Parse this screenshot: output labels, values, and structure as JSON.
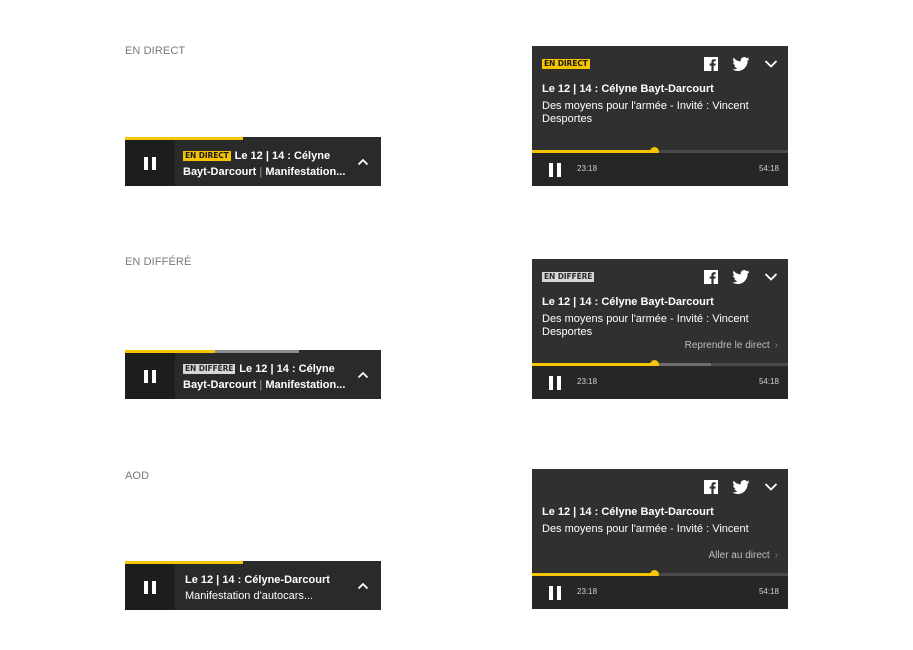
{
  "sections": [
    {
      "label": "EN DIRECT",
      "mini": {
        "badge": "EN DIRECT",
        "line1": "Le 12 | 14 : Célyne",
        "line2_bold": "Bayt-Darcourt",
        "line2_sep": " | ",
        "line2_rest": "Manifestation...",
        "progress_percent": 46,
        "buffer_percent": 46
      },
      "full": {
        "badge": "EN DIRECT",
        "title": "Le 12 | 14 : Célyne Bayt-Darcourt",
        "description": "Des moyens pour l'armée - Invité : Vincent Desportes",
        "link": "",
        "progress_percent": 47.5,
        "buffer_percent": 47.5,
        "time_current": "23:18",
        "time_duration": "54:18"
      }
    },
    {
      "label": "EN DIFFÉRÉ",
      "mini": {
        "badge": "EN DIFFÉRÉ",
        "line1": "Le 12 | 14 : Célyne",
        "line2_bold": "Bayt-Darcourt",
        "line2_sep": " | ",
        "line2_rest": "Manifestation...",
        "progress_percent": 35,
        "buffer_percent": 68
      },
      "full": {
        "badge": "EN DIFFÉRÉ",
        "title": "Le 12 | 14 : Célyne Bayt-Darcourt",
        "description": "Des moyens pour l'armée - Invité : Vincent Desportes",
        "link": "Reprendre le direct",
        "progress_percent": 47.5,
        "buffer_percent": 70,
        "time_current": "23:18",
        "time_duration": "54:18"
      }
    },
    {
      "label": "AOD",
      "mini": {
        "badge": "",
        "line1": "Le 12 | 14 : Célyne-Darcourt",
        "line2_bold": "",
        "line2_sep": "",
        "line2_rest": "Manifestation  d'autocars...",
        "progress_percent": 46,
        "buffer_percent": 46
      },
      "full": {
        "badge": "",
        "title": "Le 12 | 14 : Célyne Bayt-Darcourt",
        "description": "Des moyens pour l'armée - Invité : Vincent",
        "link": "Aller au direct",
        "progress_percent": 47.5,
        "buffer_percent": 47.5,
        "time_current": "23:18",
        "time_duration": "54:18"
      }
    }
  ],
  "icons": {
    "facebook": "facebook-icon",
    "twitter": "twitter-icon",
    "collapse": "chevron-down-icon",
    "expand": "chevron-up-icon",
    "pause": "pause-icon"
  },
  "colors": {
    "accent": "#f6c400",
    "player_bg": "#2a2a2a",
    "badge_diff": "#d6d6d6"
  }
}
